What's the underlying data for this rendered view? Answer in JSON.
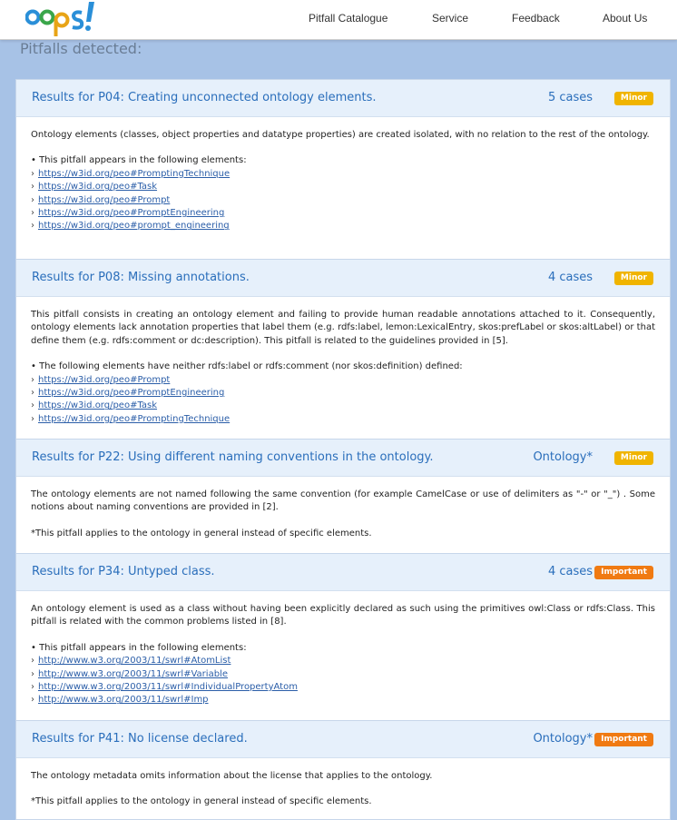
{
  "navbar": {
    "logo_text": "oops!",
    "links": [
      "Pitfall Catalogue",
      "Service",
      "Feedback",
      "About Us"
    ]
  },
  "heading": "Pitfalls detected:",
  "pitfalls": [
    {
      "title": "Results for P04: Creating unconnected ontology elements.",
      "cases": "5 cases",
      "badge": "Minor",
      "description": "Ontology elements (classes, object properties and datatype properties) are created isolated, with no relation to the rest of the ontology.",
      "list_intro": "• This pitfall appears in the following elements:",
      "links": [
        "https://w3id.org/peo#PromptingTechnique",
        "https://w3id.org/peo#Task",
        "https://w3id.org/peo#Prompt",
        "https://w3id.org/peo#PromptEngineering",
        "https://w3id.org/peo#prompt_engineering"
      ]
    },
    {
      "title": "Results for P08: Missing annotations.",
      "cases": "4 cases",
      "badge": "Minor",
      "description": "This pitfall consists in creating an ontology element and failing to provide human readable annotations attached to it. Consequently, ontology elements lack annotation properties that label them (e.g. rdfs:label, lemon:LexicalEntry, skos:prefLabel or skos:altLabel) or that define them (e.g. rdfs:comment or dc:description). This pitfall is related to the guidelines provided in [5].",
      "list_intro": "• The following elements have neither rdfs:label or rdfs:comment (nor skos:definition) defined:",
      "links": [
        "https://w3id.org/peo#Prompt",
        "https://w3id.org/peo#PromptEngineering",
        "https://w3id.org/peo#Task",
        "https://w3id.org/peo#PromptingTechnique"
      ]
    },
    {
      "title": "Results for P22: Using different naming conventions in the ontology.",
      "cases": "Ontology*",
      "badge": "Minor",
      "description": "The ontology elements are not named following the same convention (for example CamelCase or use of delimiters as \"-\" or \"_\") . Some notions about naming conventions are provided in [2].",
      "note": "*This pitfall applies to the ontology in general instead of specific elements."
    },
    {
      "title": "Results for P34: Untyped class.",
      "cases": "4 cases",
      "badge": "Important",
      "description": "An ontology element is used as a class without having been explicitly declared as such using the primitives owl:Class or rdfs:Class. This pitfall is related with the common problems listed in [8].",
      "list_intro": "• This pitfall appears in the following elements:",
      "links": [
        "http://www.w3.org/2003/11/swrl#AtomList",
        "http://www.w3.org/2003/11/swrl#Variable",
        "http://www.w3.org/2003/11/swrl#IndividualPropertyAtom",
        "http://www.w3.org/2003/11/swrl#Imp"
      ]
    },
    {
      "title": "Results for P41: No license declared.",
      "cases": "Ontology*",
      "badge": "Important",
      "description": "The ontology metadata omits information about the license that applies to the ontology.",
      "note": "*This pitfall applies to the ontology in general instead of specific elements."
    }
  ],
  "colors": {
    "page_bg": "#a7c2e6",
    "title_blue": "#2a6ebb",
    "minor_badge": "#f0b400",
    "important_badge": "#f07a12",
    "link": "#2b5ea8"
  }
}
